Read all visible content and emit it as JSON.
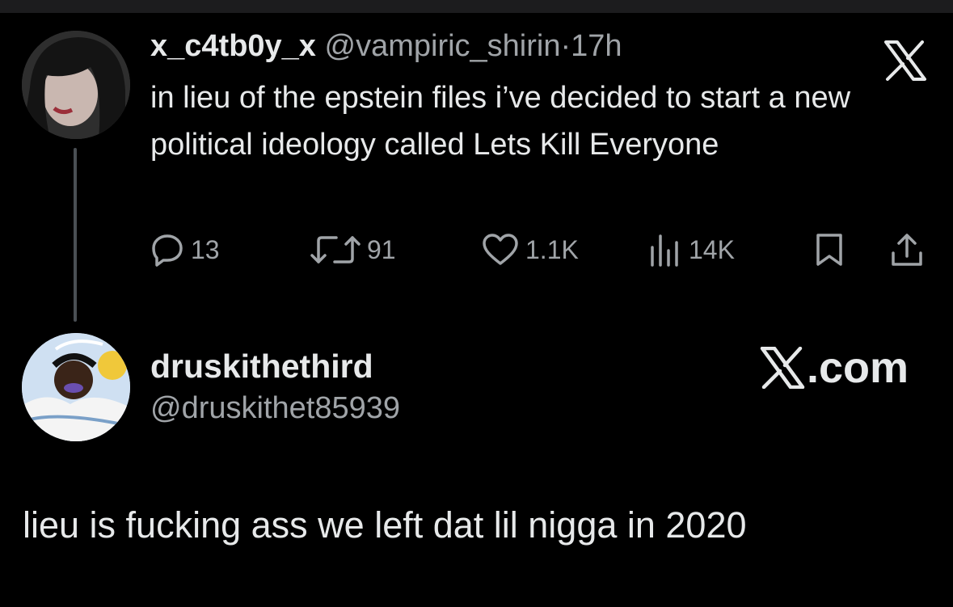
{
  "original_post": {
    "display_name": "x_c4tb0y_x",
    "handle": "@vampiric_shirin",
    "separator": "·",
    "time": "17h",
    "text": "in lieu of the epstein files i’ve decided to start a new political ideology called Lets Kill Everyone",
    "actions": {
      "replies": "13",
      "reposts": "91",
      "likes": "1.1K",
      "views": "14K"
    },
    "icons": [
      "reply-icon",
      "repost-icon",
      "like-icon",
      "views-icon",
      "bookmark-icon",
      "share-icon",
      "x-logo-icon"
    ]
  },
  "reply_card": {
    "display_name": "druskithethird",
    "handle": "@druskithet85939",
    "brand_suffix": ".com",
    "text": "lieu is fucking ass we left dat lil nigga in 2020"
  },
  "colors": {
    "background": "#000000",
    "text_primary": "#e7e9ea",
    "text_secondary": "#a0a4a8",
    "thread_line": "#4a4f54"
  }
}
